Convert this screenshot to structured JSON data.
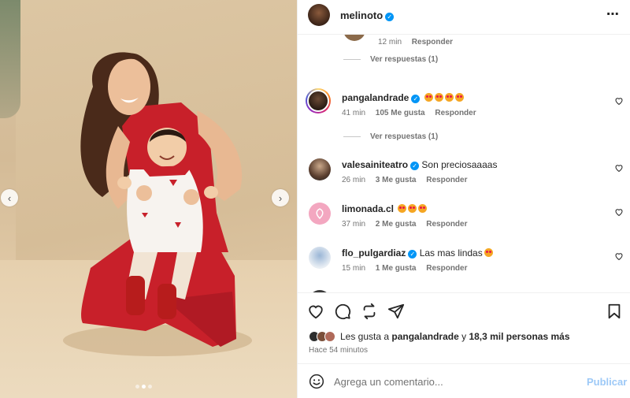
{
  "header": {
    "username": "melinoto",
    "verified_mark": "✓",
    "more_icon": "⋯"
  },
  "comments": [
    {
      "time": "12 min",
      "likes": "",
      "reply": "Responder",
      "replies": "Ver respuestas (1)"
    },
    {
      "username": "pangalandrade",
      "verified": true,
      "text": "",
      "emoji_count": 4,
      "time": "41 min",
      "likes": "105 Me gusta",
      "reply": "Responder",
      "replies": "Ver respuestas (1)"
    },
    {
      "username": "valesainiteatro",
      "verified": true,
      "text": "Son preciosaaaas",
      "time": "26 min",
      "likes": "3 Me gusta",
      "reply": "Responder"
    },
    {
      "username": "limonada.cl",
      "verified": false,
      "text": "",
      "emoji_count": 3,
      "time": "37 min",
      "likes": "2 Me gusta",
      "reply": "Responder"
    },
    {
      "username": "flo_pulgardiaz",
      "verified": true,
      "text": "Las mas lindas",
      "time": "15 min",
      "likes": "1 Me gusta",
      "reply": "Responder"
    }
  ],
  "actions": {
    "icons": [
      "heart-icon",
      "comment-icon",
      "share-icon",
      "send-icon",
      "bookmark-icon"
    ],
    "likes_prefix": "Les gusta a",
    "likes_user": "pangalandrade",
    "likes_connector": "y",
    "likes_others": "18,3 mil personas más",
    "time_ago": "Hace 54 minutos"
  },
  "comment_box": {
    "placeholder": "Agrega un comentario...",
    "publish_label": "Publicar"
  },
  "media": {
    "prev_glyph": "‹",
    "next_glyph": "›",
    "slides": 3,
    "active_slide": 1
  },
  "colors": {
    "accent": "#0095f6",
    "publish_disabled": "#9dc9f7",
    "dress": "#c8202a"
  }
}
